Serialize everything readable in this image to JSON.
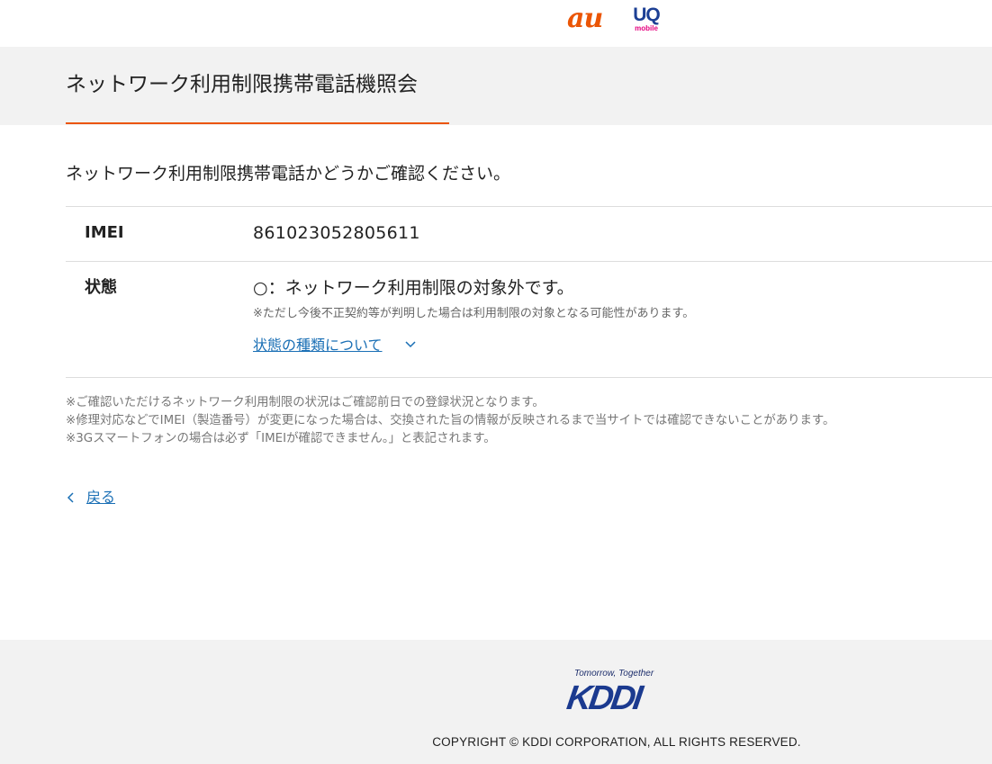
{
  "header": {
    "au_logo": "au",
    "uq_logo": "UQ",
    "uq_logo_sub": "mobile"
  },
  "page": {
    "title": "ネットワーク利用制限携帯電話機照会",
    "lead": "ネットワーク利用制限携帯電話かどうかご確認ください。"
  },
  "result": {
    "imei_label": "IMEI",
    "imei_value": "861023052805611",
    "status_label": "状態",
    "status_value": "○：ネットワーク利用制限の対象外です。",
    "status_note": "※ただし今後不正契約等が判明した場合は利用制限の対象となる可能性があります。",
    "status_types_link": "状態の種類について"
  },
  "notes": [
    "※ご確認いただけるネットワーク利用制限の状況はご確認前日での登録状況となります。",
    "※修理対応などでIMEI（製造番号）が変更になった場合は、交換された旨の情報が反映されるまで当サイトでは確認できないことがあります。",
    "※3Gスマートフォンの場合は必ず「IMEIが確認できません。」と表記されます。"
  ],
  "back_link": "戻る",
  "footer": {
    "tagline": "Tomorrow, Together",
    "brand": "KDDI",
    "copyright": "COPYRIGHT © KDDI CORPORATION, ALL RIGHTS RESERVED."
  },
  "colors": {
    "accent": "#eb5505",
    "link": "#1a6fb5",
    "band_background": "#f2f2f2",
    "kddi_blue": "#1b3a8f"
  },
  "icons": {
    "status_types_toggle": "chevron-down-icon",
    "back": "chevron-left-icon"
  }
}
